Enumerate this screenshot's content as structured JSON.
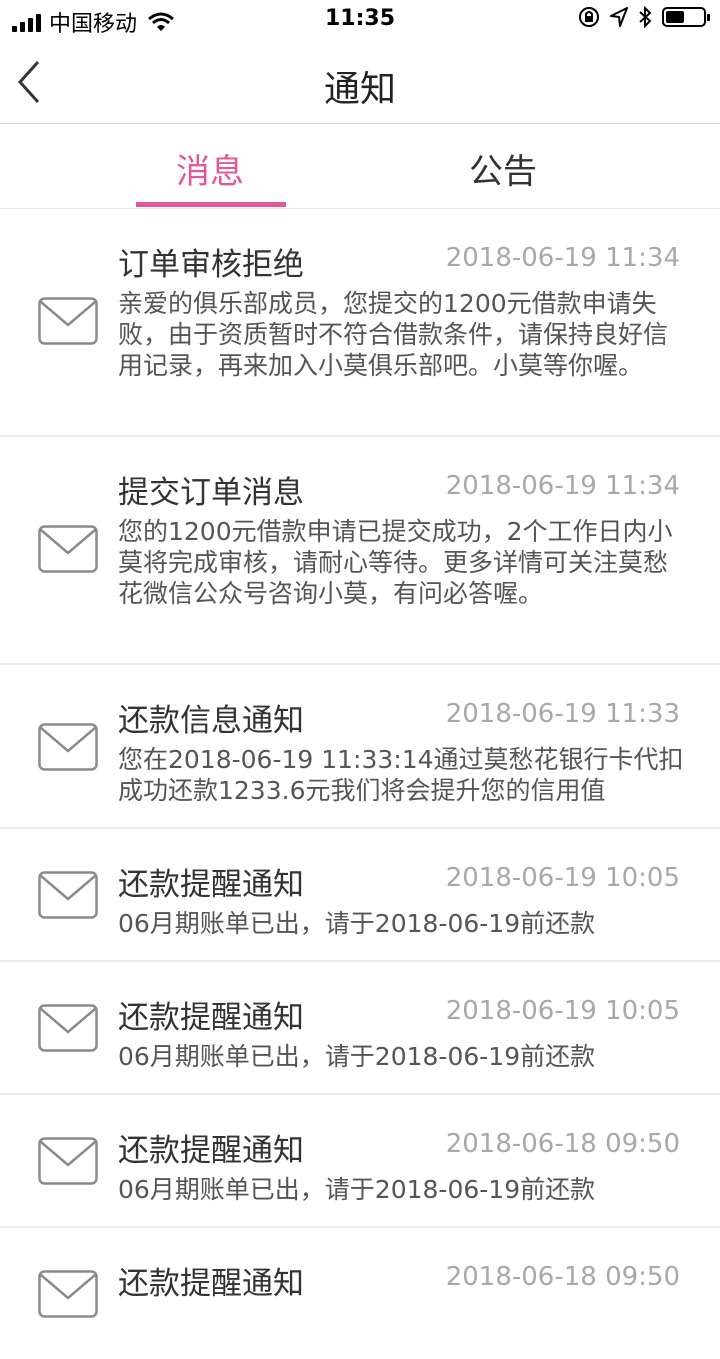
{
  "status_bar": {
    "carrier": "中国移动",
    "time": "11:35"
  },
  "nav": {
    "title": "通知"
  },
  "tabs": [
    {
      "label": "消息",
      "active": true
    },
    {
      "label": "公告",
      "active": false
    }
  ],
  "colors": {
    "accent": "#e05a9a",
    "divider": "#ececec"
  },
  "messages": [
    {
      "title": "订单审核拒绝",
      "time": "2018-06-19 11:34",
      "body": "亲爱的俱乐部成员，您提交的1200元借款申请失败，由于资质暂时不符合借款条件，请保持良好信用记录，再来加入小莫俱乐部吧。小莫等你喔。"
    },
    {
      "title": "提交订单消息",
      "time": "2018-06-19 11:34",
      "body": "您的1200元借款申请已提交成功，2个工作日内小莫将完成审核，请耐心等待。更多详情可关注莫愁花微信公众号咨询小莫，有问必答喔。"
    },
    {
      "title": "还款信息通知",
      "time": "2018-06-19 11:33",
      "body": "您在2018-06-19 11:33:14通过莫愁花银行卡代扣成功还款1233.6元我们将会提升您的信用值"
    },
    {
      "title": "还款提醒通知",
      "time": "2018-06-19 10:05",
      "body": "06月期账单已出，请于2018-06-19前还款"
    },
    {
      "title": "还款提醒通知",
      "time": "2018-06-19 10:05",
      "body": "06月期账单已出，请于2018-06-19前还款"
    },
    {
      "title": "还款提醒通知",
      "time": "2018-06-18 09:50",
      "body": "06月期账单已出，请于2018-06-19前还款"
    },
    {
      "title": "还款提醒通知",
      "time": "2018-06-18 09:50",
      "body": ""
    }
  ]
}
